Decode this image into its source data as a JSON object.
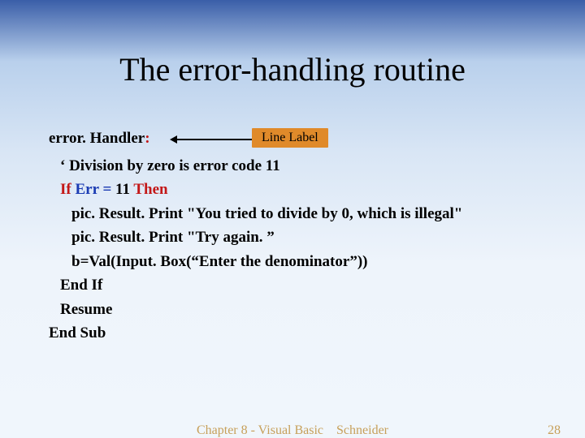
{
  "title": "The error-handling routine",
  "handler": {
    "name": "error. Handler",
    "colon": ":"
  },
  "labelbox": "Line Label",
  "code": {
    "comment": "‘ Division by zero is error code 11",
    "if_kw": "If",
    "err_kw": "Err",
    "eq_kw": " = ",
    "eleven": "11",
    "then_kw": " Then",
    "print1": "pic. Result. Print \"You tried to divide by 0, which is illegal\"",
    "print2": "pic. Result. Print \"Try again. ”",
    "assign": "b=Val(Input. Box(“Enter the denominator”))",
    "endif": "End If",
    "resume": "Resume",
    "endsub": "End Sub"
  },
  "footer": {
    "center": "Chapter 8 - Visual Basic Schneider",
    "page": "28"
  }
}
